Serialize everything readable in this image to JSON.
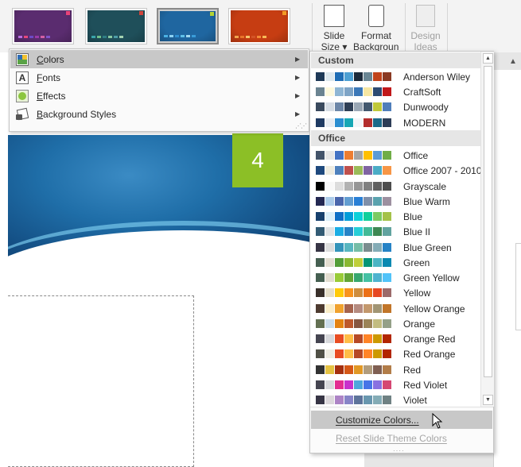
{
  "ribbon": {
    "variant_thumbs": [
      {
        "bg": "#5a2c6f",
        "flag": "#e8437a",
        "dots": [
          "#b86be0",
          "#e5477c",
          "#6d4ac4",
          "#9b3aa8",
          "#d35fa4",
          "#7f52c9"
        ]
      },
      {
        "bg": "#1f4f5a",
        "flag": "#d0443b",
        "dots": [
          "#39a4a9",
          "#6fbf8b",
          "#2e7d84",
          "#88c9a1",
          "#4c9ca6",
          "#a3d1b0"
        ]
      },
      {
        "bg": "#1f66a0",
        "flag": "#b4d333",
        "dots": [
          "#4ab0e3",
          "#8bd1f2",
          "#2e8fd1",
          "#5fc0e8",
          "#a0d8f0",
          "#3a9cd8"
        ]
      },
      {
        "bg": "#c63d12",
        "flag": "#f39a26",
        "dots": [
          "#f0a34c",
          "#e8742a",
          "#f6c46a",
          "#d35427",
          "#f28a37",
          "#f7b956"
        ]
      }
    ],
    "buttons": [
      {
        "label": "Slide\nSize ▾"
      },
      {
        "label": "Format\nBackground"
      },
      {
        "label": "Design\nIdeas"
      }
    ]
  },
  "slide": {
    "number": "4"
  },
  "variants_menu": {
    "items": [
      {
        "label": "Colors",
        "accelerator": "C",
        "rest": "olors",
        "icon": "colors-icon"
      },
      {
        "label": "Fonts",
        "accelerator": "F",
        "rest": "onts",
        "icon": "fonts-icon"
      },
      {
        "label": "Effects",
        "accelerator": "E",
        "rest": "ffects",
        "icon": "effects-icon"
      },
      {
        "label": "Background Styles",
        "accelerator": "B",
        "rest": "ackground Styles",
        "icon": "background-styles-icon"
      }
    ]
  },
  "colors_panel": {
    "custom_header": "Custom",
    "office_header": "Office",
    "custom": [
      {
        "name": "Anderson Wiley",
        "colors": [
          "#1f3a58",
          "#dde8ee",
          "#1f6db5",
          "#4da0d3",
          "#1c2a3a",
          "#6a8694",
          "#c1441c",
          "#8a3a23"
        ]
      },
      {
        "name": "CraftSoft",
        "colors": [
          "#6b8491",
          "#fdf9dd",
          "#8fb6d4",
          "#7ea4c6",
          "#3b78b8",
          "#f5e6a3",
          "#2c4a72",
          "#c0181a"
        ]
      },
      {
        "name": "Dunwoody",
        "colors": [
          "#3a4a5e",
          "#d6dde5",
          "#6d87a8",
          "#2f3f56",
          "#9aa7b5",
          "#42586f",
          "#c0c93a",
          "#4f7ebb"
        ]
      },
      {
        "name": "MODERN",
        "colors": [
          "#1f3b63",
          "#e7ecf2",
          "#2b8ed1",
          "#18a7b5",
          "#f3f5f8",
          "#b32d2d",
          "#1c6a8a",
          "#2d3d57"
        ]
      }
    ],
    "office": [
      {
        "name": "Office",
        "colors": [
          "#44546a",
          "#e7e6e6",
          "#4472c4",
          "#ed7d31",
          "#a5a5a5",
          "#ffc000",
          "#5b9bd5",
          "#70ad47"
        ]
      },
      {
        "name": "Office 2007 - 2010",
        "colors": [
          "#1f497d",
          "#eeece1",
          "#4f81bd",
          "#c0504d",
          "#9bbb59",
          "#8064a2",
          "#4bacc6",
          "#f79646"
        ]
      },
      {
        "name": "Grayscale",
        "colors": [
          "#000000",
          "#f8f8f8",
          "#dddddd",
          "#b2b2b2",
          "#969696",
          "#808080",
          "#5f5f5f",
          "#4d4d4d"
        ]
      },
      {
        "name": "Blue Warm",
        "colors": [
          "#242852",
          "#acccea",
          "#4a66ac",
          "#629dd1",
          "#297fd5",
          "#7f8fa9",
          "#5aa2ae",
          "#9d90a0"
        ]
      },
      {
        "name": "Blue",
        "colors": [
          "#17406d",
          "#dbeff9",
          "#0f6fc6",
          "#009dd9",
          "#0bd0d9",
          "#10cf9b",
          "#7cca62",
          "#a5c249"
        ]
      },
      {
        "name": "Blue II",
        "colors": [
          "#335b74",
          "#dfe3e5",
          "#1cade4",
          "#2683c6",
          "#27ced7",
          "#42ba97",
          "#3e8853",
          "#62a39f"
        ]
      },
      {
        "name": "Blue Green",
        "colors": [
          "#373545",
          "#dedede",
          "#3494ba",
          "#58b6c0",
          "#75bda7",
          "#7a8c8e",
          "#84acb6",
          "#2683c6"
        ]
      },
      {
        "name": "Green",
        "colors": [
          "#455f51",
          "#e3ded1",
          "#549e39",
          "#8ab833",
          "#c0cf3a",
          "#029676",
          "#4ab5c4",
          "#0989b1"
        ]
      },
      {
        "name": "Green Yellow",
        "colors": [
          "#455f51",
          "#e3ded1",
          "#99cb38",
          "#63a537",
          "#37a76f",
          "#44c1a3",
          "#4eb3cf",
          "#51c3f9"
        ]
      },
      {
        "name": "Yellow",
        "colors": [
          "#39302a",
          "#e5dec9",
          "#ffca08",
          "#f8931d",
          "#ce8d3e",
          "#ec7016",
          "#e64823",
          "#9c6a6a"
        ]
      },
      {
        "name": "Yellow Orange",
        "colors": [
          "#4e3b30",
          "#fbeec9",
          "#f0a22e",
          "#a5644e",
          "#b58b80",
          "#c3986d",
          "#a19574",
          "#c17529"
        ]
      },
      {
        "name": "Orange",
        "colors": [
          "#637052",
          "#ccddea",
          "#e48312",
          "#bd582c",
          "#865640",
          "#9b8357",
          "#c2bc80",
          "#94a088"
        ]
      },
      {
        "name": "Orange Red",
        "colors": [
          "#454551",
          "#d8d9dc",
          "#e84c22",
          "#ffbd47",
          "#b64926",
          "#ff8427",
          "#cc9900",
          "#b22600"
        ]
      },
      {
        "name": "Red Orange",
        "colors": [
          "#505046",
          "#eeece1",
          "#e84c22",
          "#ffbd47",
          "#b64926",
          "#ff8427",
          "#cc9900",
          "#b22600"
        ]
      },
      {
        "name": "Red",
        "colors": [
          "#323232",
          "#e5c243",
          "#a5300f",
          "#d55816",
          "#e19825",
          "#b19c7d",
          "#7f5f52",
          "#b27d49"
        ]
      },
      {
        "name": "Red Violet",
        "colors": [
          "#454551",
          "#d8d9dc",
          "#e32d91",
          "#c830cc",
          "#4ea6dc",
          "#4775e7",
          "#8971e1",
          "#d54773"
        ]
      },
      {
        "name": "Violet",
        "colors": [
          "#373545",
          "#dcd8dc",
          "#ad84c6",
          "#8784c7",
          "#5d739a",
          "#6997af",
          "#84acb6",
          "#6f8183"
        ]
      }
    ],
    "footer": {
      "customize": "Customize Colors...",
      "reset": "Reset Slide Theme Colors"
    }
  }
}
